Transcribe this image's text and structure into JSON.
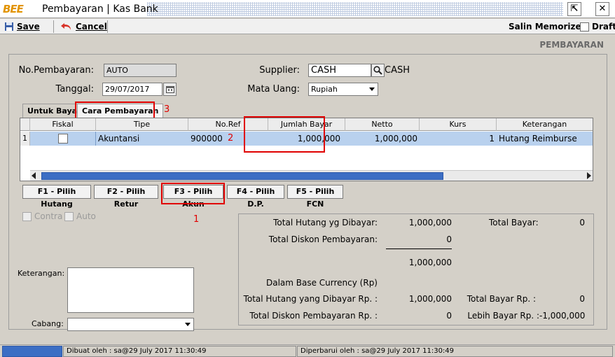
{
  "window": {
    "logo": "BEE",
    "title": "Pembayaran | Kas Bank",
    "restore_glyph": "⇱",
    "close_glyph": "✕"
  },
  "toolbar": {
    "save_label": "Save",
    "cancel_label": "Cancel",
    "salin_memorized_label": "Salin Memorized",
    "draft_label": "Draft"
  },
  "form_title": "PEMBAYARAN",
  "header": {
    "no_pembayaran_label": "No.Pembayaran:",
    "no_pembayaran_value": "AUTO",
    "tanggal_label": "Tanggal:",
    "tanggal_value": "29/07/2017",
    "supplier_label": "Supplier:",
    "supplier_value": "CASH",
    "supplier_name": "CASH",
    "mata_uang_label": "Mata Uang:",
    "mata_uang_value": "Rupiah"
  },
  "tabs": [
    {
      "label": "Untuk Bayar"
    },
    {
      "label": "Cara Pembayaran"
    }
  ],
  "grid": {
    "columns": [
      "Fiskal",
      "Tipe",
      "No.Ref",
      "Jumlah Bayar",
      "Netto",
      "Kurs",
      "Keterangan"
    ],
    "rows": [
      {
        "num": "1",
        "tipe": "Akuntansi",
        "no_ref": "900000",
        "jumlah_bayar": "1,000,000",
        "netto": "1,000,000",
        "kurs": "1",
        "keterangan": "Hutang Reimburse"
      }
    ]
  },
  "function_buttons": [
    "F1 - Pilih Hutang",
    "F2 - Pilih Retur",
    "F3 - Pilih Akun",
    "F4 - Pilih D.P.",
    "F5 - Pilih FCN"
  ],
  "annotations": {
    "a1": "1",
    "a2": "2",
    "a3": "3"
  },
  "options": {
    "contra_label": "Contra",
    "auto_label": "Auto"
  },
  "bottom_left": {
    "keterangan_label": "Keterangan:",
    "cabang_label": "Cabang:"
  },
  "summary": {
    "total_hutang_label": "Total Hutang yg Dibayar:",
    "total_hutang_value": "1,000,000",
    "total_diskon_label": "Total Diskon Pembayaran:",
    "total_diskon_value": "0",
    "subtotal_value": "1,000,000",
    "total_bayar_label": "Total Bayar:",
    "total_bayar_value": "0",
    "base_currency_label": "Dalam Base Currency (Rp)",
    "total_hutang_rp_label": "Total Hutang yang Dibayar Rp. :",
    "total_hutang_rp_value": "1,000,000",
    "total_bayar_rp_label": "Total Bayar Rp. :",
    "total_bayar_rp_value": "0",
    "total_diskon_rp_label": "Total Diskon Pembayaran Rp. :",
    "total_diskon_rp_value": "0",
    "lebih_bayar_label": "Lebih Bayar Rp. :",
    "lebih_bayar_value": "-1,000,000"
  },
  "status": {
    "dibuat": "Dibuat oleh : sa@29 July 2017  11:30:49",
    "diperbarui": "Diperbarui oleh : sa@29 July 2017  11:30:49"
  }
}
